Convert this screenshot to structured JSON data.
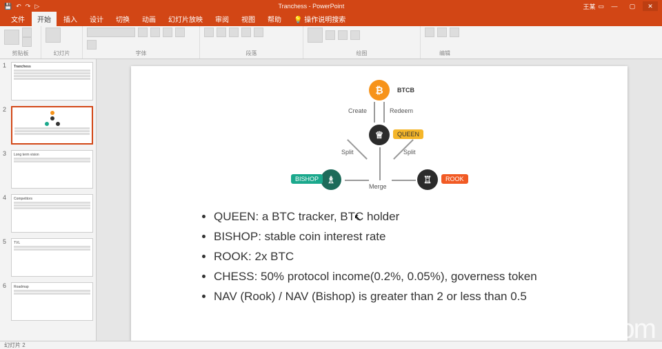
{
  "app": {
    "title": "Tranchess - PowerPoint",
    "user": "王某",
    "window_controls": {
      "min": "—",
      "max": "▢",
      "close": "✕"
    }
  },
  "qa_icons": [
    "save-icon",
    "undo-icon",
    "redo-icon",
    "slideshow-icon"
  ],
  "menu": {
    "file": "文件",
    "tabs": [
      "开始",
      "插入",
      "设计",
      "切换",
      "动画",
      "幻灯片放映",
      "审阅",
      "视图",
      "帮助"
    ],
    "tell_me": "操作说明搜索"
  },
  "ribbon_groups": [
    {
      "name": "剪贴板",
      "label": "剪贴板"
    },
    {
      "name": "幻灯片",
      "label": "幻灯片"
    },
    {
      "name": "字体",
      "label": "字体"
    },
    {
      "name": "段落",
      "label": "段落"
    },
    {
      "name": "绘图",
      "label": "绘图"
    },
    {
      "name": "编辑",
      "label": "编辑"
    }
  ],
  "thumbnails": [
    {
      "num": "1",
      "title": "Tranchess"
    },
    {
      "num": "2",
      "title": ""
    },
    {
      "num": "3",
      "title": "Long term vision"
    },
    {
      "num": "4",
      "title": "Competitors"
    },
    {
      "num": "5",
      "title": "TVL"
    },
    {
      "num": "6",
      "title": "Roadmap"
    }
  ],
  "selected_thumb": 1,
  "slide": {
    "nodes": {
      "btc": {
        "glyph": "₿",
        "label": "BTCB"
      },
      "queen": {
        "glyph": "♕",
        "label": "QUEEN"
      },
      "bishop": {
        "glyph": "♗",
        "label": "BISHOP"
      },
      "rook": {
        "glyph": "♖",
        "label": "ROOK"
      }
    },
    "edges": {
      "create": "Create",
      "redeem": "Redeem",
      "split_l": "Split",
      "split_r": "Split",
      "merge": "Merge"
    },
    "bullets": [
      "QUEEN: a BTC tracker, BTC holder",
      "BISHOP: stable coin interest rate",
      "ROOK: 2x BTC",
      "CHESS: 50% protocol income(0.2%, 0.05%), governess token",
      "NAV (Rook) / NAV (Bishop) is greater than 2 or less than 0.5"
    ]
  },
  "status": {
    "left": "幻灯片 2"
  },
  "watermark": "zoom"
}
